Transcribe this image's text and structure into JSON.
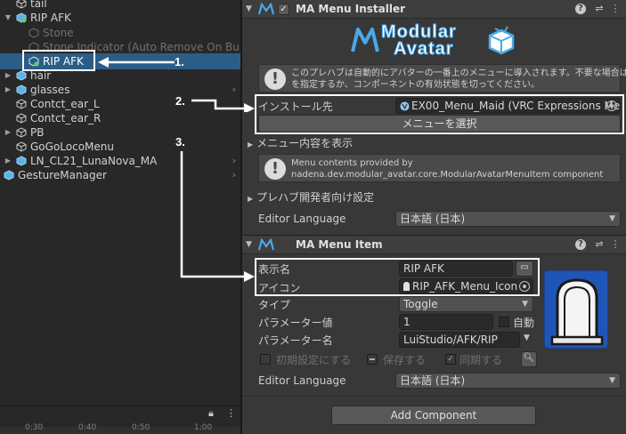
{
  "hierarchy": {
    "items": [
      {
        "label": "tail"
      },
      {
        "label": "RIP AFK"
      },
      {
        "label": "Stone"
      },
      {
        "label": "Stone Indicator (Auto Remove On Build)"
      },
      {
        "label": "RIP AFK"
      },
      {
        "label": "hair"
      },
      {
        "label": "glasses"
      },
      {
        "label": "Contct_ear_L"
      },
      {
        "label": "Contct_ear_R"
      },
      {
        "label": "PB"
      },
      {
        "label": "GoGoLocoMenu"
      },
      {
        "label": "LN_CL21_LunaNova_MA"
      },
      {
        "label": "GestureManager"
      }
    ],
    "timeline": {
      "t1": "0:30",
      "t2": "0:40",
      "t3": "0:50",
      "t4": "1:00"
    }
  },
  "annotations": {
    "a1": "1.",
    "a2": "2.",
    "a3": "3."
  },
  "installer": {
    "title": "MA Menu Installer",
    "logo_line1": "Modular",
    "logo_line2": "Avatar",
    "help_line1": "このプレハブは自動的にアバターの一番上のメニューに導入されます。不要な場合は別のメニュー",
    "help_line2": "を指定するか、コンポーネントの有効状態を切ってください。",
    "install_label": "インストール先",
    "install_value": "EX00_Menu_Maid (VRC Expressions Me",
    "select_menu_button": "メニューを選択",
    "show_contents": "メニュー内容を表示",
    "provided_line1": "Menu contents provided by",
    "provided_line2": "nadena.dev.modular_avatar.core.ModularAvatarMenuItem component",
    "prefab_dev_settings": "プレハブ開発者向け設定",
    "editor_language_label": "Editor Language",
    "editor_language_value": "日本語 (日本)"
  },
  "menu_item": {
    "title": "MA Menu Item",
    "display_name_label": "表示名",
    "display_name_value": "RIP AFK",
    "icon_label": "アイコン",
    "icon_value": "RIP_AFK_Menu_Icon",
    "type_label": "タイプ",
    "type_value": "Toggle",
    "param_value_label": "パラメーター値",
    "param_value": "1",
    "auto_label": "自動",
    "param_name_label": "パラメーター名",
    "param_name_value": "LuiStudio/AFK/RIP",
    "initial_setting": "初期設定にする",
    "save_label": "保存する",
    "sync_label": "同期する",
    "editor_language_label": "Editor Language",
    "editor_language_value": "日本語 (日本)"
  },
  "add_component": "Add Component",
  "colors": {
    "selection": "#2c5d87",
    "accent": "#4aa8e8"
  }
}
